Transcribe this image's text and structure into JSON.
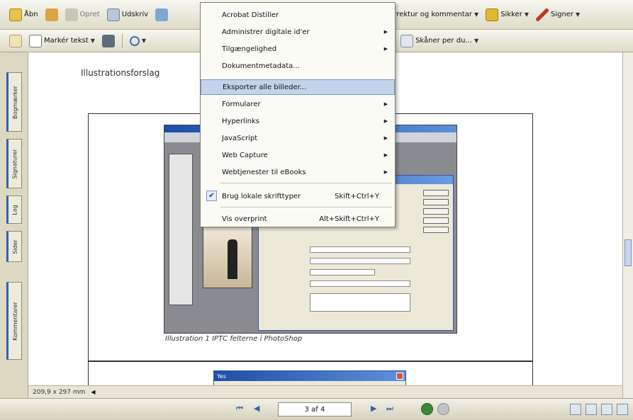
{
  "toolbar1": {
    "open": "Åbn",
    "create": "Opret",
    "print": "Udskriv",
    "comment": "Korrektur og kommentar",
    "secure": "Sikker",
    "sign": "Signer"
  },
  "toolbar2": {
    "select_text": "Markér tekst",
    "hands": "Skåner per du..."
  },
  "left_tabs": [
    "Bogmærker",
    "Signaturer",
    "Lag",
    "Sider",
    "Kommentarer"
  ],
  "document": {
    "heading": "Illustrationsforslag",
    "caption": "Illustration 1 IPTC felterne i PhotoShop",
    "dialog_title": "Yes"
  },
  "status": {
    "page_size": "209,9 x 297 mm",
    "page_indicator": "3 af 4"
  },
  "menu": {
    "items": [
      {
        "label": "Acrobat Distiller",
        "submenu": false
      },
      {
        "label": "Administrer digitale id'er",
        "submenu": true
      },
      {
        "label": "Tilgængelighed",
        "submenu": true
      },
      {
        "label": "Dokumentmetadata...",
        "submenu": false
      },
      {
        "label": "Eksporter alle billeder...",
        "submenu": false,
        "highlighted": true
      },
      {
        "label": "Formularer",
        "submenu": true
      },
      {
        "label": "Hyperlinks",
        "submenu": true
      },
      {
        "label": "JavaScript",
        "submenu": true
      },
      {
        "label": "Web Capture",
        "submenu": true
      },
      {
        "label": "Webtjenester til eBooks",
        "submenu": true
      },
      {
        "label": "Brug lokale skrifttyper",
        "shortcut": "Skift+Ctrl+Y",
        "checked": true
      },
      {
        "label": "Vis overprint",
        "shortcut": "Alt+Skift+Ctrl+Y"
      }
    ]
  },
  "colors": {
    "accent_blue": "#2f63b0",
    "toolbar_bg": "#e8e5d6",
    "menu_highlight": "#c3d3ea"
  }
}
